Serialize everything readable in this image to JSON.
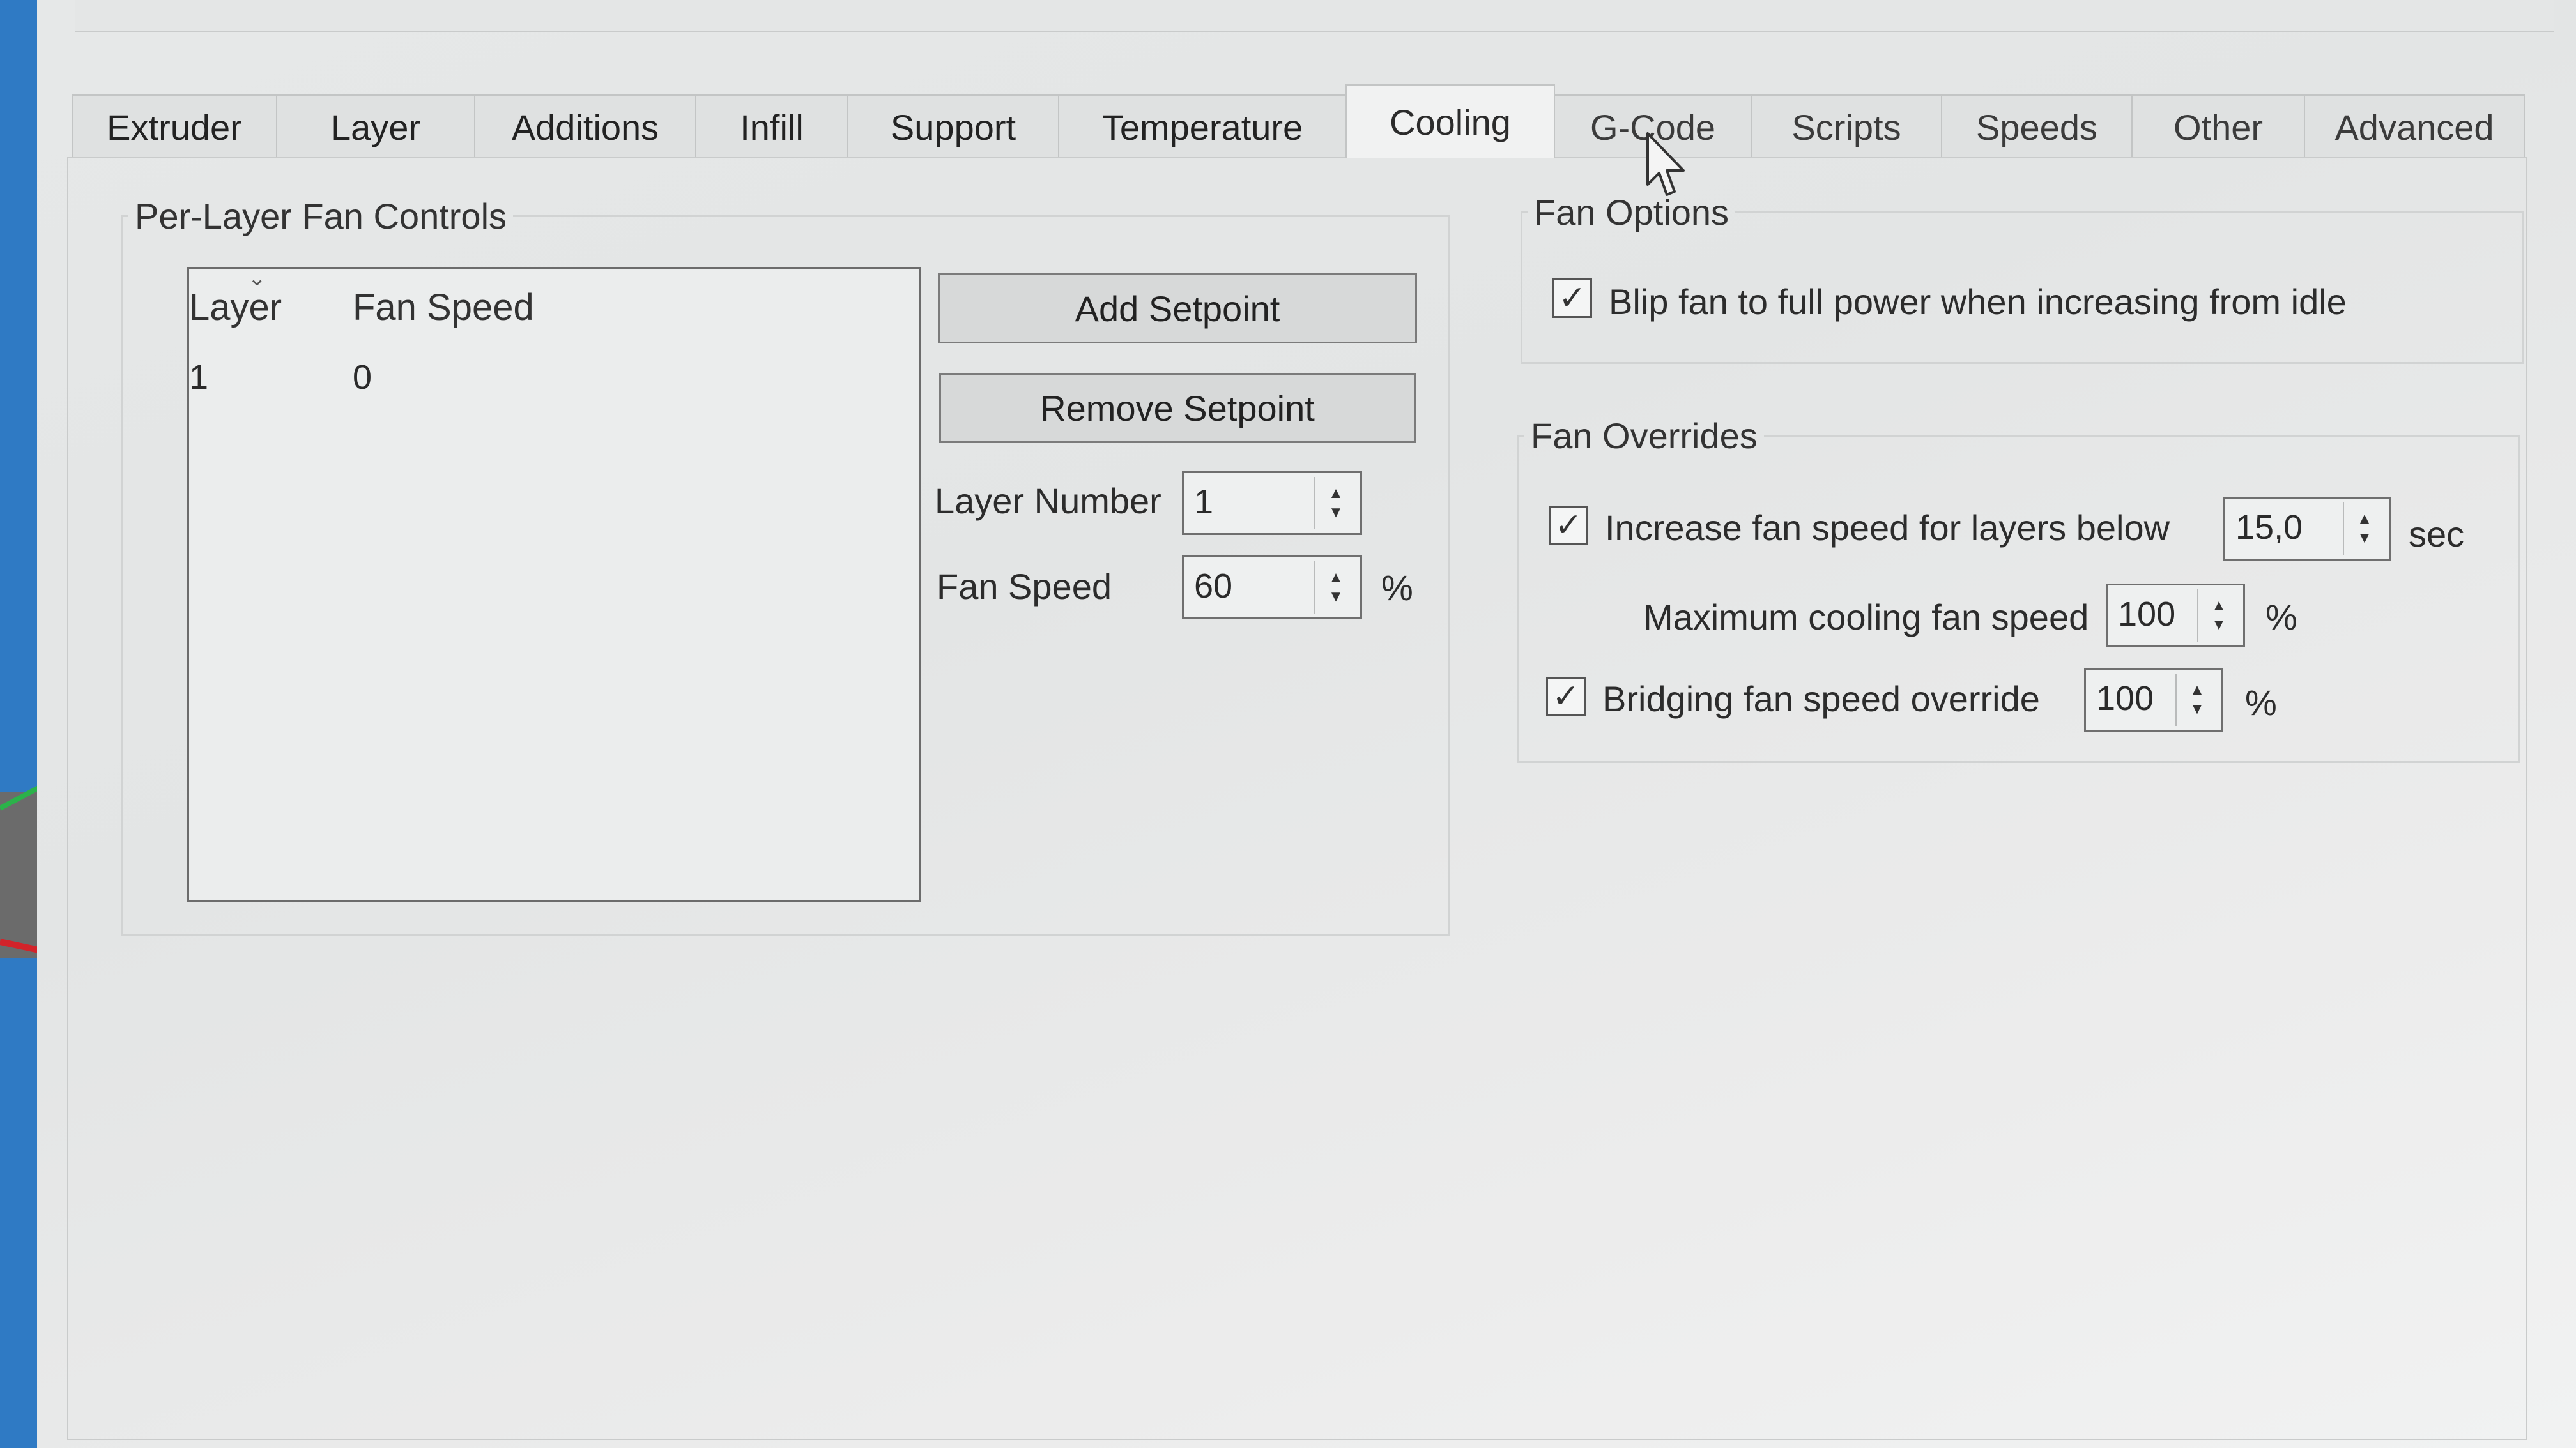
{
  "tabs": [
    {
      "label": "Extruder"
    },
    {
      "label": "Layer"
    },
    {
      "label": "Additions"
    },
    {
      "label": "Infill"
    },
    {
      "label": "Support"
    },
    {
      "label": "Temperature"
    },
    {
      "label": "Cooling"
    },
    {
      "label": "G-Code"
    },
    {
      "label": "Scripts"
    },
    {
      "label": "Speeds"
    },
    {
      "label": "Other"
    },
    {
      "label": "Advanced"
    }
  ],
  "active_tab": "Cooling",
  "per_layer": {
    "title": "Per-Layer Fan Controls",
    "columns": [
      "Layer",
      "Fan Speed"
    ],
    "rows": [
      {
        "layer": "1",
        "fan_speed": "0"
      }
    ],
    "add_button": "Add Setpoint",
    "remove_button": "Remove Setpoint",
    "layer_number_label": "Layer Number",
    "layer_number_value": "1",
    "fan_speed_label": "Fan Speed",
    "fan_speed_value": "60",
    "fan_speed_unit": "%"
  },
  "fan_options": {
    "title": "Fan Options",
    "blip_label": "Blip fan to full power when increasing from idle",
    "blip_checked": true
  },
  "fan_overrides": {
    "title": "Fan Overrides",
    "increase_label": "Increase fan speed for layers below",
    "increase_checked": true,
    "increase_value": "15,0",
    "increase_unit": "sec",
    "max_cooling_label": "Maximum cooling fan speed",
    "max_cooling_value": "100",
    "max_cooling_unit": "%",
    "bridging_label": "Bridging fan speed override",
    "bridging_checked": true,
    "bridging_value": "100",
    "bridging_unit": "%"
  }
}
